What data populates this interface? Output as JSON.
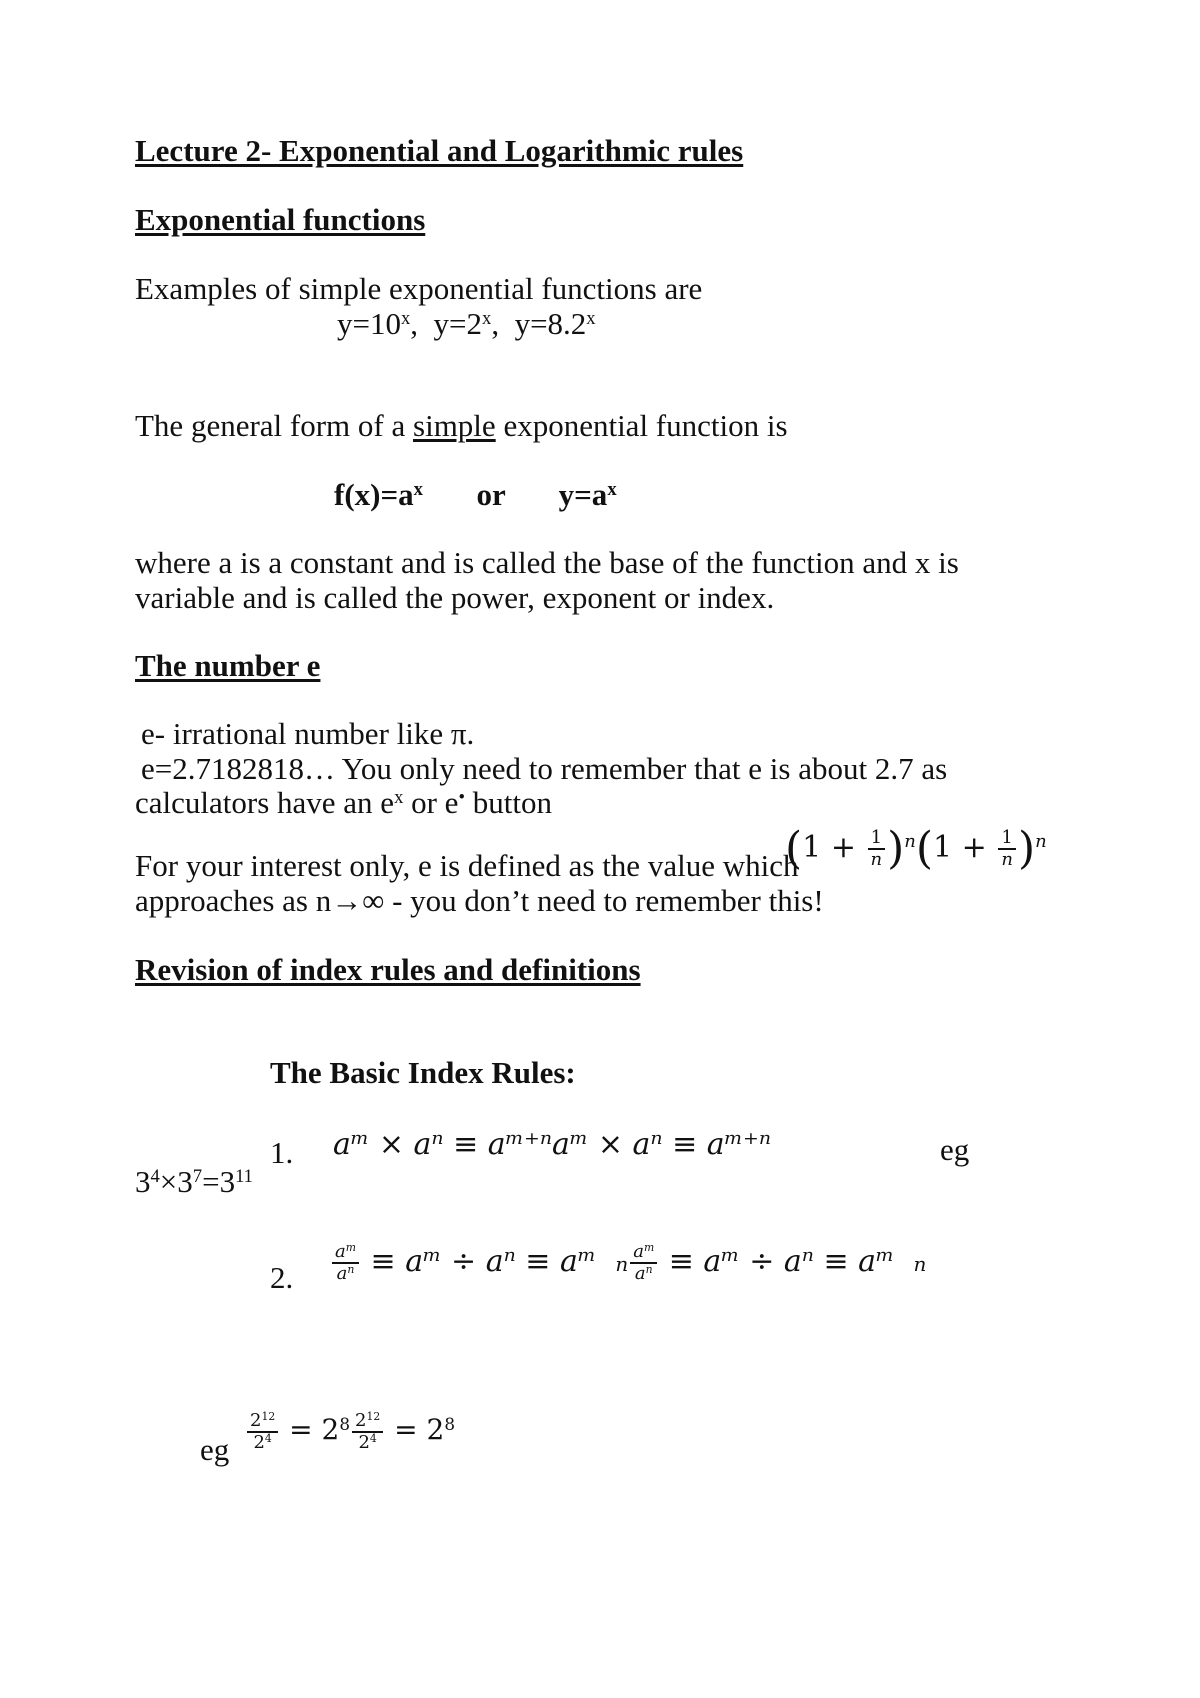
{
  "document": {
    "title": "Lecture 2- Exponential and Logarithmic rules",
    "sections": {
      "exponential": {
        "heading": "Exponential functions",
        "intro": "Examples of simple exponential functions are",
        "examples": [
          {
            "base": "y=10",
            "exp": "x",
            "sep": ","
          },
          {
            "base": "y=2",
            "exp": "x",
            "sep": ","
          },
          {
            "base": "y=8.2",
            "exp": "x",
            "sep": ""
          }
        ],
        "general_pre": "The general form of a ",
        "general_emph": "simple",
        "general_post": " exponential function is",
        "form_left_base": "f(x)=a",
        "form_left_exp": "x",
        "form_or": "or",
        "form_right_base": "y=a",
        "form_right_exp": "x",
        "where_line1": "where a is a constant and is called the base of the function and x is",
        "where_line2": "variable and is called the power, exponent or index."
      },
      "number_e": {
        "heading": "The number e",
        "line1": "e- irrational number like π.",
        "line2": "e=2.7182818…  You only need to remember that e is about 2.7 as",
        "line3_pre": "calculators have an e",
        "line3_sup1": "x",
        "line3_mid": " or e",
        "line3_sup2": "•",
        "line3_post": " button",
        "interest_line1": "For your interest only, e is defined as the value which",
        "interest_line2": "approaches as n→∞ - you don’t need to remember this!",
        "formula": {
          "one": "1",
          "plus": "+",
          "num": "1",
          "den": "n",
          "power": "n"
        }
      },
      "revision": {
        "heading": "Revision of index rules and definitions",
        "subheading": "The Basic Index Rules:",
        "rules": [
          {
            "number": "1.",
            "expression": "aᵐ × aⁿ ≡ aᵐ⁺ⁿ",
            "eg_label": "eg",
            "example": {
              "a": "3",
              "ae": "4",
              "op": "×",
              "b": "3",
              "be": "7",
              "eq": "=",
              "c": "3",
              "ce": "11"
            }
          },
          {
            "number": "2.",
            "frac_num": "a",
            "frac_num_exp": "m",
            "frac_den": "a",
            "frac_den_exp": "n",
            "rest": "≡ aᵐ ÷ aⁿ ≡ aᵐ",
            "trail": "n",
            "eg_label": "eg",
            "example": {
              "num": "2",
              "num_exp": "12",
              "den": "2",
              "den_exp": "4",
              "eq": "=",
              "res": "2",
              "res_exp": "8"
            }
          }
        ]
      }
    }
  }
}
